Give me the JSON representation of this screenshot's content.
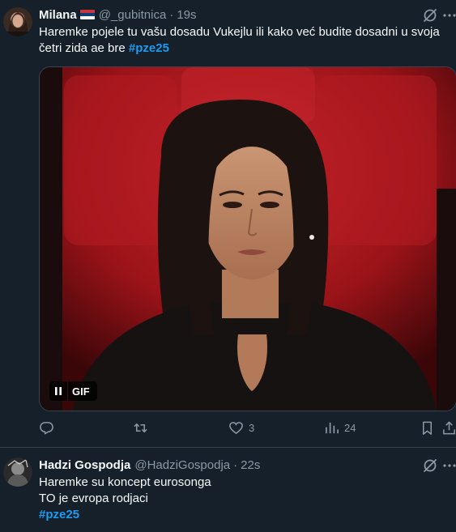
{
  "tweets": [
    {
      "author_name": "Milana",
      "flag": "serbia-flag",
      "handle": "@_gubitnica",
      "separator": "·",
      "time": "19s",
      "text_line1": "Haremke pojele tu vašu dosadu Vukejlu ili kako već budite dosadni u svoja",
      "text_line2": "četri zida ae bre",
      "hashtag": "#pze25",
      "media": {
        "type": "gif",
        "label": "GIF"
      },
      "actions": {
        "reply": "",
        "retweet": "",
        "likes": "3",
        "views": "24"
      }
    },
    {
      "author_name": "Hadzi Gospodja",
      "handle": "@HadziGospodja",
      "separator": "·",
      "time": "22s",
      "text_line1": "Haremke su koncept eurosonga",
      "text_line2": "TO je evropa rodjaci",
      "hashtag": "#pze25"
    }
  ],
  "colors": {
    "background": "#15202b",
    "text": "#f7f9f9",
    "secondary": "#8b98a5",
    "accent": "#1d9bf0",
    "border": "#38444d"
  },
  "icons": [
    "grok-icon",
    "more-icon",
    "pause-icon",
    "reply-icon",
    "retweet-icon",
    "like-icon",
    "views-icon",
    "bookmark-icon",
    "share-icon"
  ]
}
